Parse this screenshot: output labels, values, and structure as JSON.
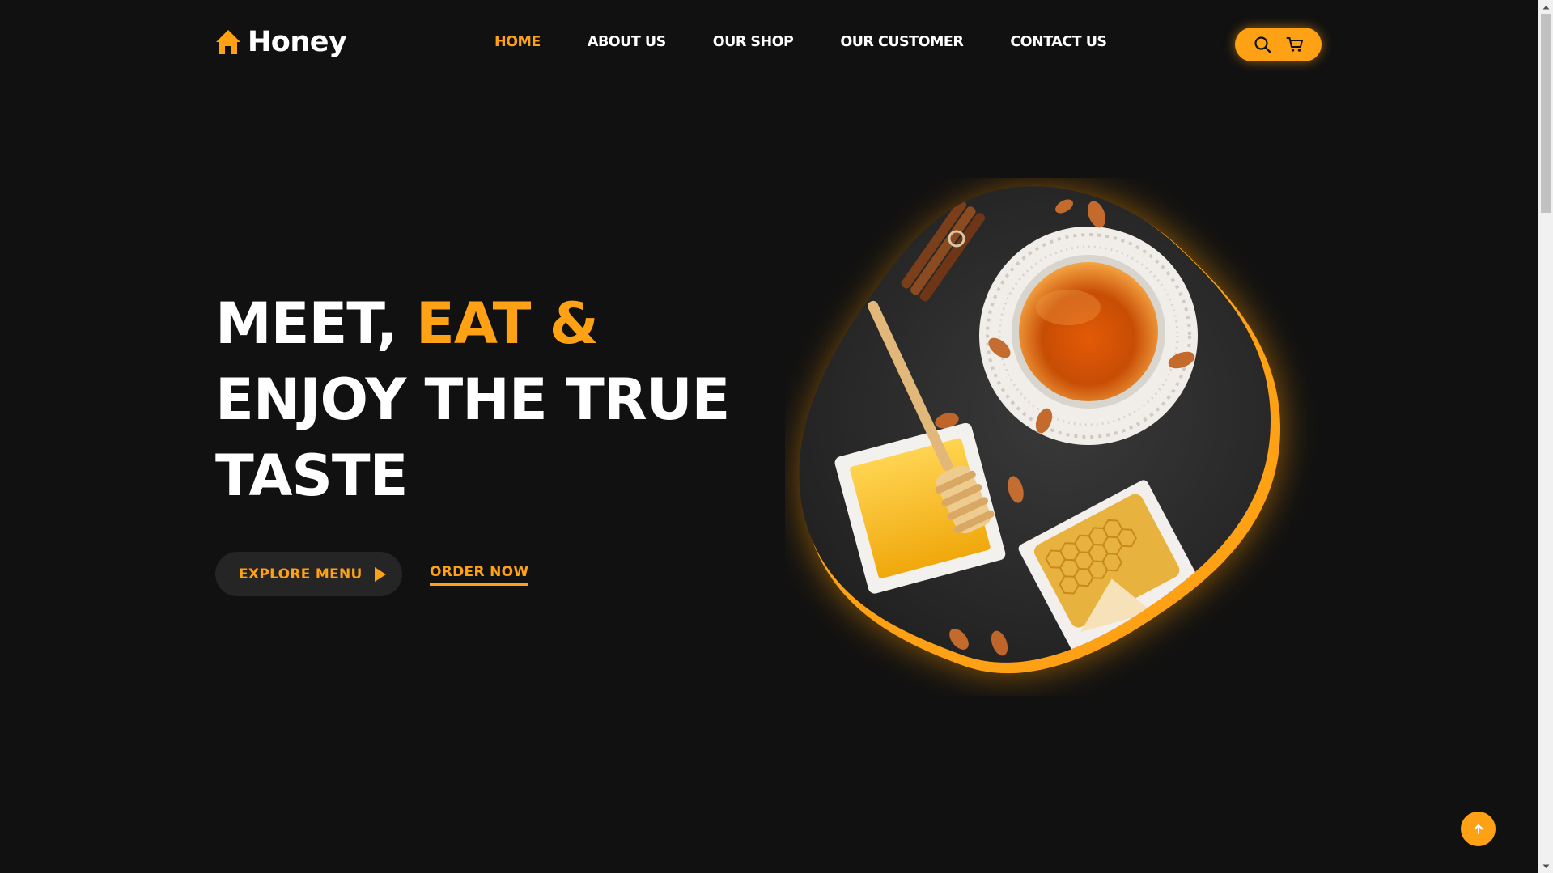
{
  "brand": {
    "name": "Honey",
    "logo_icon": "home-icon"
  },
  "nav": {
    "items": [
      {
        "label": "HOME",
        "active": true
      },
      {
        "label": "ABOUT US",
        "active": false
      },
      {
        "label": "OUR SHOP",
        "active": false
      },
      {
        "label": "OUR CUSTOMER",
        "active": false
      },
      {
        "label": "CONTACT US",
        "active": false
      }
    ],
    "actions": {
      "search_icon": "search-icon",
      "cart_icon": "cart-icon"
    }
  },
  "hero": {
    "title_part1": "MEET, ",
    "title_accent": "EAT &",
    "title_line2": "ENJOY THE TRUE",
    "title_line3": "TASTE",
    "explore_label": "EXPLORE MENU",
    "explore_icon": "play-icon",
    "order_label": "ORDER NOW",
    "image_subject": "honey-plate-image"
  },
  "scroll_top": {
    "icon": "arrow-up-icon"
  },
  "colors": {
    "accent": "#ffa114",
    "background": "#111111",
    "text": "#ffffff",
    "button_dark": "#252525"
  }
}
